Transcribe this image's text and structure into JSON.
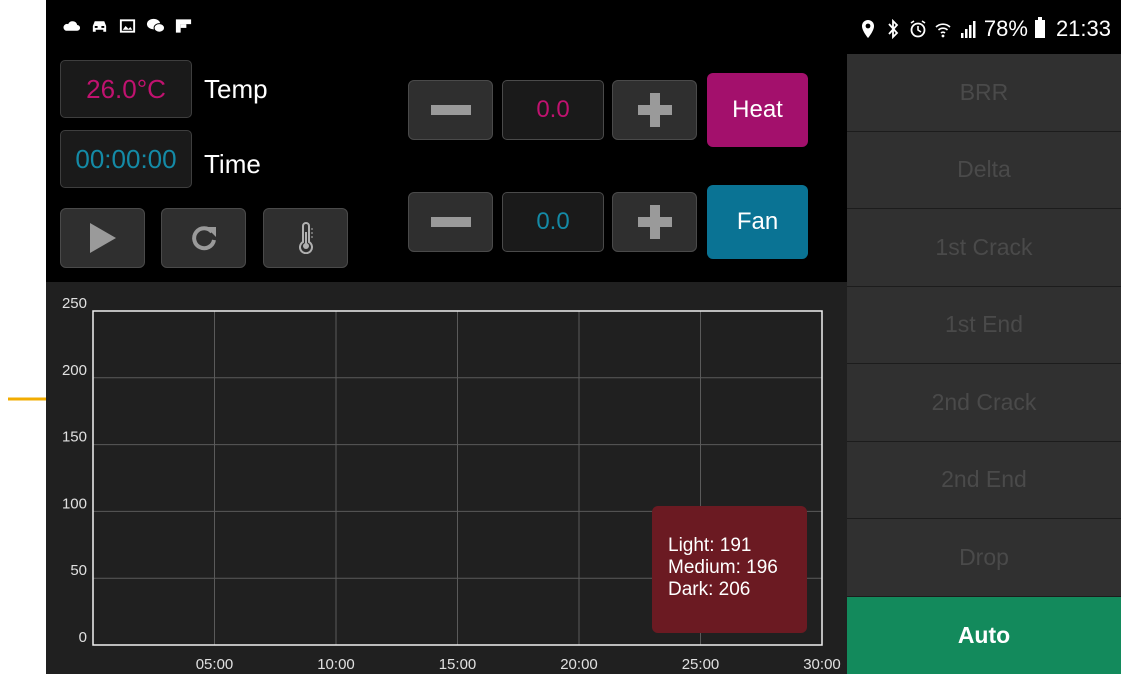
{
  "status_bar": {
    "left_icons": [
      "cloud-icon",
      "car-icon",
      "gallery-icon",
      "wechat-icon",
      "flipboard-icon"
    ],
    "right_icons": [
      "location-icon",
      "bluetooth-icon",
      "alarm-icon",
      "wifi-icon",
      "signal-icon"
    ],
    "battery": "78%",
    "time": "21:33"
  },
  "readouts": {
    "temp_value": "26.0°C",
    "temp_label": "Temp",
    "time_value": "00:00:00",
    "time_label": "Time"
  },
  "playback": {
    "play_icon": "play-icon",
    "reset_icon": "refresh-icon",
    "thermometer_icon": "thermometer-icon"
  },
  "heat": {
    "value": "0.0",
    "button": "Heat",
    "color": "#a3106c"
  },
  "fan": {
    "value": "0.0",
    "button": "Fan",
    "color": "#0a7394"
  },
  "side_buttons": [
    {
      "label": "BRR",
      "active": false
    },
    {
      "label": "Delta",
      "active": false
    },
    {
      "label": "1st Crack",
      "active": false
    },
    {
      "label": "1st End",
      "active": false
    },
    {
      "label": "2nd Crack",
      "active": false
    },
    {
      "label": "2nd End",
      "active": false
    },
    {
      "label": "Drop",
      "active": false
    },
    {
      "label": "Auto",
      "active": true,
      "color": "#138a5c"
    }
  ],
  "tooltip": {
    "light": "Light: 191",
    "medium": "Medium: 196",
    "dark": "Dark: 206"
  },
  "colors": {
    "temp_text": "#c0126f",
    "time_text": "#148aa6",
    "annotation_arrow": "#f2ac00"
  },
  "chart_data": {
    "type": "line",
    "title": "",
    "xlabel": "",
    "ylabel": "",
    "x_ticks": [
      "05:00",
      "10:00",
      "15:00",
      "20:00",
      "25:00",
      "30:00"
    ],
    "y_ticks": [
      0,
      50,
      100,
      150,
      200,
      250
    ],
    "xlim": [
      0,
      30
    ],
    "ylim": [
      0,
      250
    ],
    "grid": true,
    "series": []
  }
}
